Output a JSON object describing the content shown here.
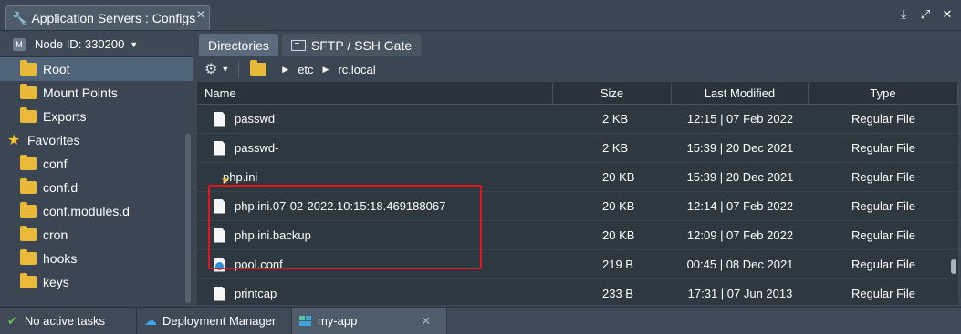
{
  "window": {
    "title": "Application Servers : Configs",
    "close_glyph": "✕",
    "controls": {
      "download": "⤓",
      "expand": "⤢",
      "close": "✕"
    }
  },
  "sidebar": {
    "node_label": "Node ID: 330200",
    "node_badge": "M",
    "items": [
      {
        "label": "Root",
        "icon": "folder-icon",
        "selected": true
      },
      {
        "label": "Mount Points",
        "icon": "folder-icon"
      },
      {
        "label": "Exports",
        "icon": "exports-icon"
      }
    ],
    "favorites_label": "Favorites",
    "favorites": [
      "conf",
      "conf.d",
      "conf.modules.d",
      "cron",
      "hooks",
      "keys"
    ]
  },
  "tabs": [
    {
      "label": "Directories",
      "active": true
    },
    {
      "label": "SFTP / SSH Gate",
      "active": false
    }
  ],
  "path": {
    "segments": [
      "etc",
      "rc.local"
    ]
  },
  "table": {
    "headers": {
      "name": "Name",
      "size": "Size",
      "modified": "Last Modified",
      "type": "Type"
    },
    "rows": [
      {
        "name": "passwd",
        "size": "2 KB",
        "modified": "12:15 | 07 Feb 2022",
        "type": "Regular File",
        "icon": "file"
      },
      {
        "name": "passwd-",
        "size": "2 KB",
        "modified": "15:39 | 20 Dec 2021",
        "type": "Regular File",
        "icon": "file"
      },
      {
        "name": "php.ini",
        "size": "20 KB",
        "modified": "15:39 | 20 Dec 2021",
        "type": "Regular File",
        "icon": "config-favorite"
      },
      {
        "name": "php.ini.07-02-2022.10:15:18.469188067",
        "size": "20 KB",
        "modified": "12:14 | 07 Feb 2022",
        "type": "Regular File",
        "icon": "file"
      },
      {
        "name": "php.ini.backup",
        "size": "20 KB",
        "modified": "12:09 | 07 Feb 2022",
        "type": "Regular File",
        "icon": "file"
      },
      {
        "name": "pool.conf",
        "size": "219 B",
        "modified": "00:45 | 08 Dec 2021",
        "type": "Regular File",
        "icon": "config"
      },
      {
        "name": "printcap",
        "size": "233 B",
        "modified": "17:31 | 07 Jun 2013",
        "type": "Regular File",
        "icon": "file"
      }
    ]
  },
  "taskbar": {
    "tasks_label": "No active tasks",
    "deployment_label": "Deployment Manager",
    "env_label": "my-app"
  },
  "colors": {
    "highlight": "#e0161c",
    "folder": "#e9b93a",
    "accent": "#3da3ee"
  }
}
